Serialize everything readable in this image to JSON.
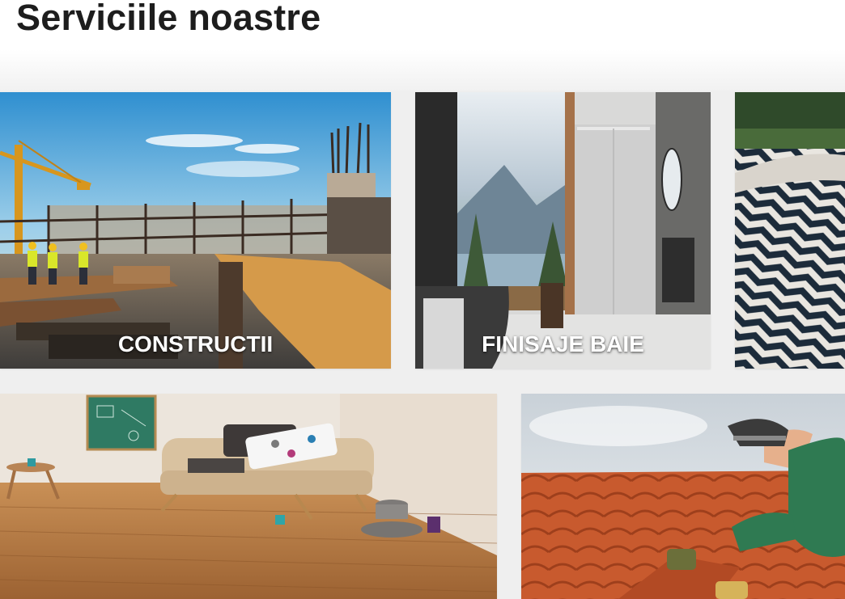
{
  "header": {
    "title": "Serviciile noastre"
  },
  "services": [
    {
      "label": "CONSTRUCTII",
      "image": "construction-site-photo"
    },
    {
      "label": "FINISAJE BAIE",
      "image": "bathroom-photo"
    },
    {
      "label": "",
      "image": "paving-stones-photo"
    },
    {
      "label": "",
      "image": "wooden-floor-photo"
    },
    {
      "label": "",
      "image": "roof-tiles-photo"
    }
  ]
}
